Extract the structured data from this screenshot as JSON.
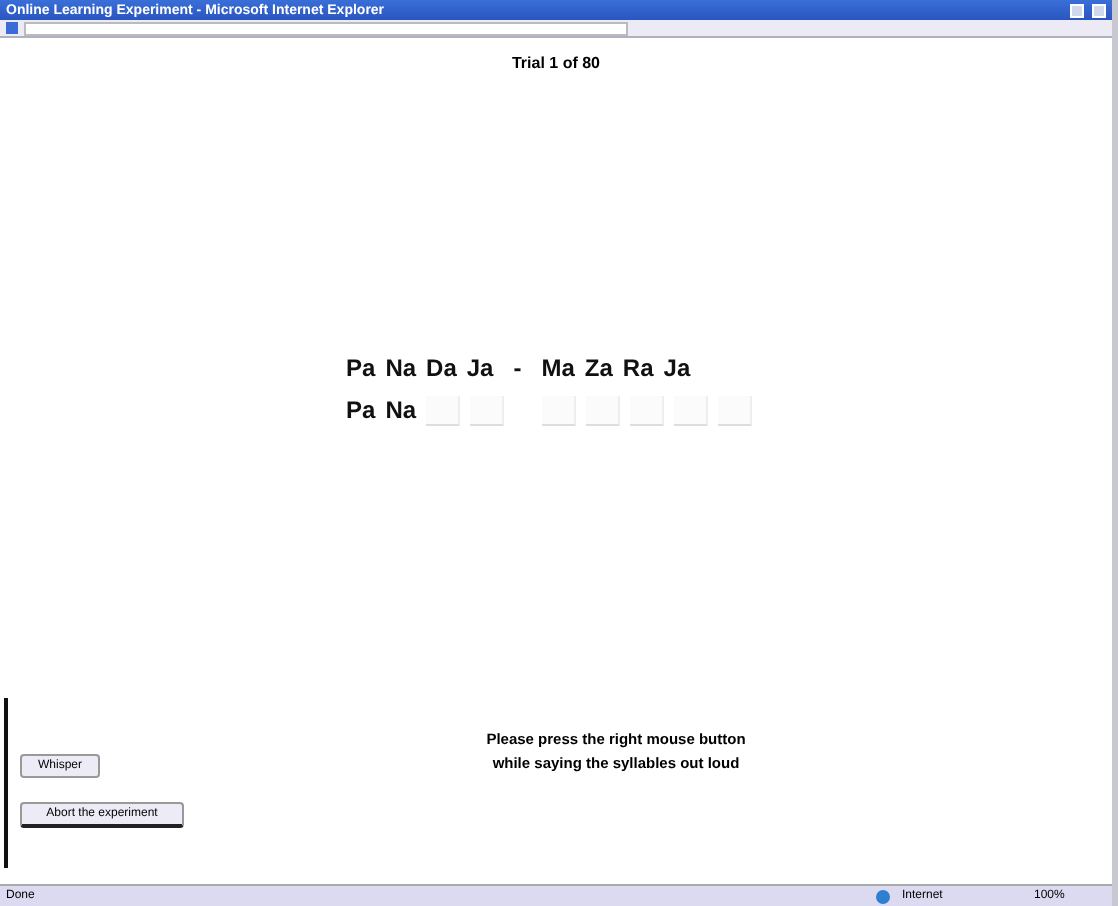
{
  "window": {
    "title": "Online Learning Experiment - Microsoft Internet Explorer"
  },
  "trial": "Trial 1 of 80",
  "target": [
    "Pa",
    "Na",
    "Da",
    "Ja",
    "-",
    "Ma",
    "Za",
    "Ra",
    "Ja"
  ],
  "response": [
    "Pa",
    "Na"
  ],
  "instruction": [
    "Please press the right mouse button",
    "while saying the syllables out loud"
  ],
  "buttons": [
    "Whisper",
    "Abort the experiment"
  ],
  "status_bar": {
    "text": "Done",
    "zone": "Internet",
    "zoom": "100%"
  }
}
